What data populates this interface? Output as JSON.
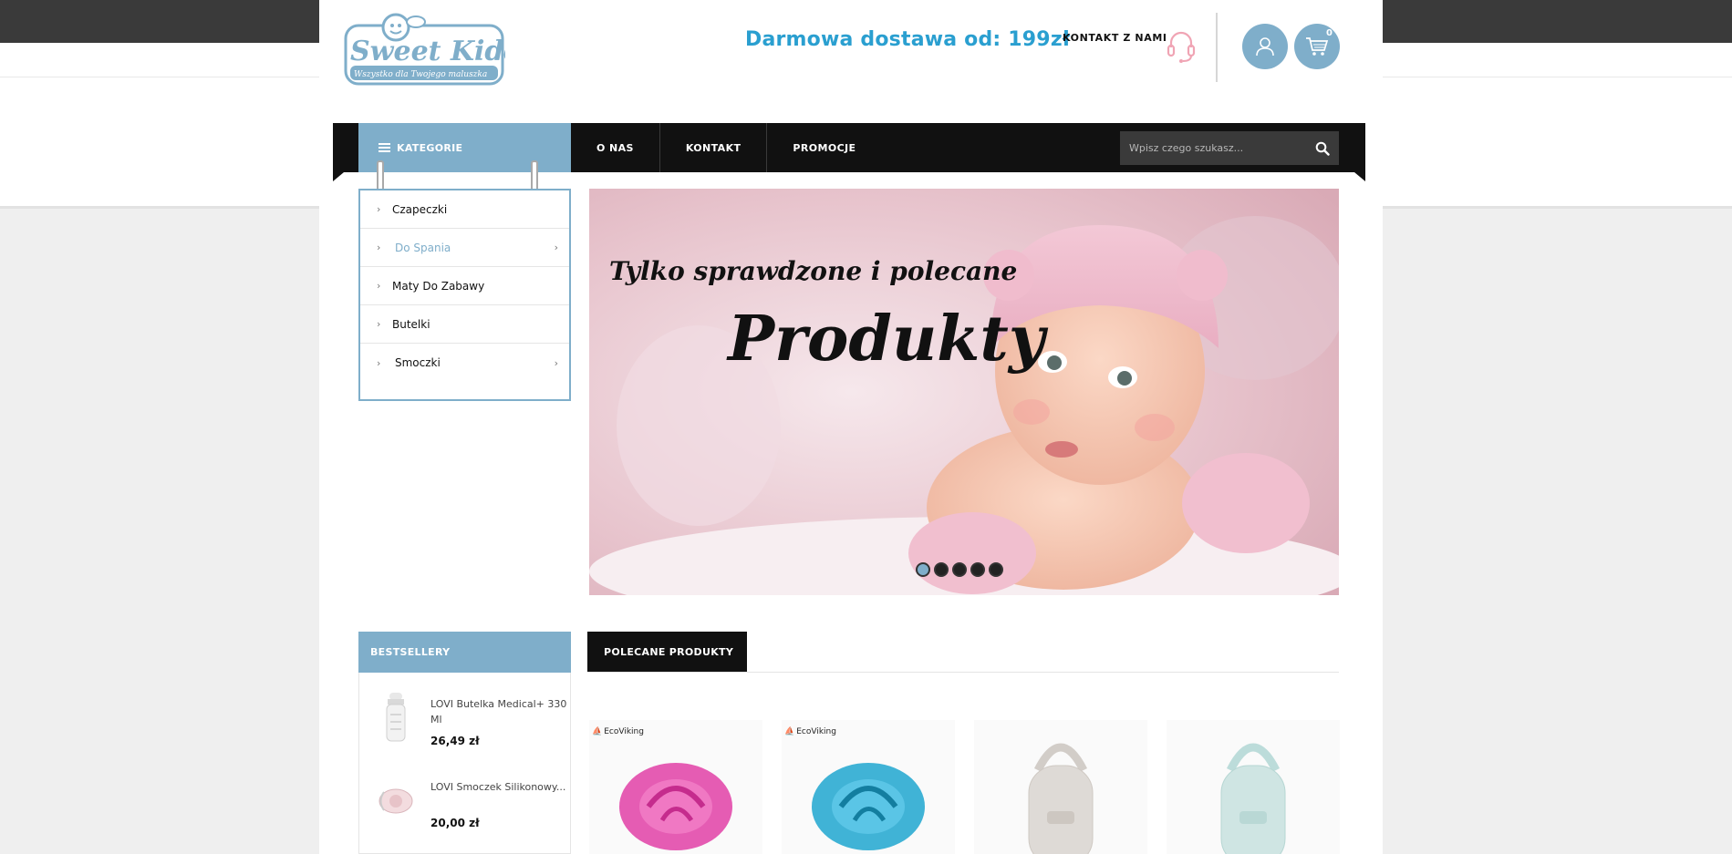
{
  "header": {
    "logo_title": "Sweet Kiddy",
    "logo_tagline": "Wszystko dla Twojego maluszka",
    "promo_text": "Darmowa dostawa od: 199zł",
    "contact_label": "KONTAKT Z NAMI",
    "cart_count": "0"
  },
  "nav": {
    "categories_label": "KATEGORIE",
    "links": [
      "O NAS",
      "KONTAKT",
      "PROMOCJE"
    ],
    "search_placeholder": "Wpisz czego szukasz..."
  },
  "categories": [
    {
      "label": "Czapeczki",
      "submenu": false,
      "active": false
    },
    {
      "label": "Do Spania",
      "submenu": true,
      "active": true
    },
    {
      "label": "Maty Do Zabawy",
      "submenu": false,
      "active": false
    },
    {
      "label": "Butelki",
      "submenu": false,
      "active": false
    },
    {
      "label": "Smoczki",
      "submenu": true,
      "active": false
    }
  ],
  "hero": {
    "line1": "Tylko sprawdzone i polecane",
    "line2": "Produkty",
    "slide_count": 5,
    "active_slide": 1
  },
  "bestsellers": {
    "title": "BESTSELLERY",
    "items": [
      {
        "name": "LOVI Butelka Medical+ 330 Ml",
        "price": "26,49 zł"
      },
      {
        "name": "LOVI Smoczek Silikonowy...",
        "price": "20,00 zł"
      }
    ]
  },
  "recommended": {
    "tab_label": "POLECANE PRODUKTY",
    "products": [
      {
        "brand": "EcoViking",
        "color": "#e03fa6"
      },
      {
        "brand": "EcoViking",
        "color": "#1fa6cf"
      },
      {
        "brand": "",
        "color": "#dedad6"
      },
      {
        "brand": "",
        "color": "#cfe5e3"
      }
    ]
  },
  "colors": {
    "accent": "#7faeca",
    "promo": "#2a9fd0",
    "nav_bg": "#111111"
  }
}
